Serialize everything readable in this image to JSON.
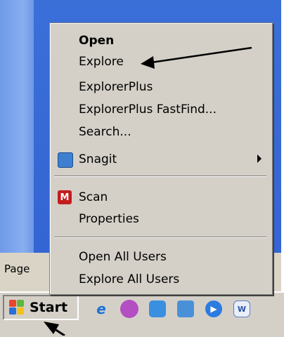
{
  "desktop": {
    "partial_label": "Page"
  },
  "context_menu": {
    "items": [
      {
        "label": "Open",
        "bold": true
      },
      {
        "label": "Explore"
      },
      {
        "label": "ExplorerPlus"
      },
      {
        "label": "ExplorerPlus FastFind..."
      },
      {
        "label": "Search..."
      },
      {
        "label": "Snagit",
        "icon": "snagit-icon",
        "has_submenu": true
      },
      {
        "label": "Scan",
        "icon": "scan-icon",
        "icon_letter": "M"
      },
      {
        "label": "Properties"
      },
      {
        "label": "Open All Users"
      },
      {
        "label": "Explore All Users"
      }
    ]
  },
  "taskbar": {
    "start_label": "Start",
    "quick_launch_icons": [
      "internet-explorer-icon",
      "media-icon",
      "network-icon",
      "snagit-icon",
      "media-player-icon",
      "word-icon"
    ]
  },
  "annotations": {
    "arrow_color": "#000000"
  }
}
